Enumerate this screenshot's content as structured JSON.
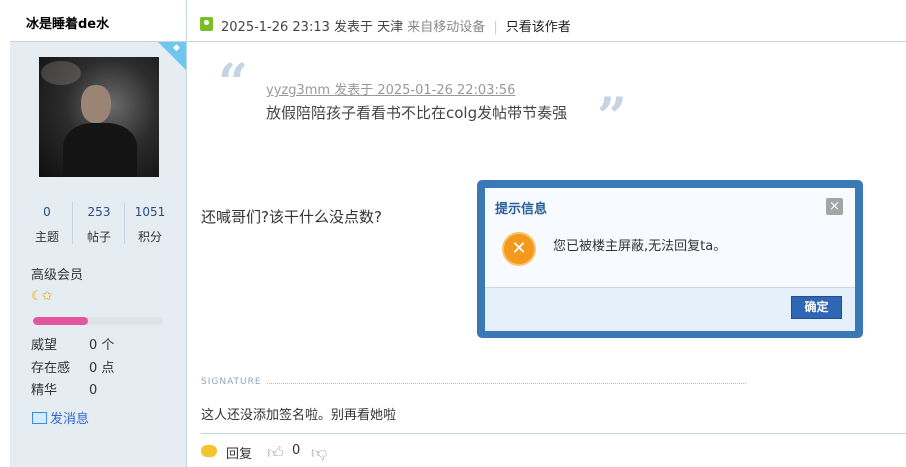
{
  "author": {
    "name": "冰是睡着de水",
    "stats": [
      {
        "value": "0",
        "label": "主题"
      },
      {
        "value": "253",
        "label": "帖子"
      },
      {
        "value": "1051",
        "label": "积分"
      }
    ],
    "group": "高级会员",
    "level_icons": "☾✩",
    "progress_fraction": 0.42,
    "progress_color": "#e4579e",
    "props": [
      {
        "label": "威望",
        "value": "0 个"
      },
      {
        "label": "存在感",
        "value": "0 点"
      },
      {
        "label": "精华",
        "value": "0"
      }
    ],
    "send_message": "发消息"
  },
  "post_header": {
    "datetime": "2025-1-26 23:13",
    "posted_in": "发表于 天津",
    "device": "来自移动设备",
    "separator": "|",
    "only_author": "只看该作者"
  },
  "quote": {
    "open_mark": "“",
    "close_mark": "”",
    "meta": "yyzg3mm 发表于 2025-01-26 22:03:56",
    "text": "放假陪陪孩子看看书不比在colg发帖带节奏强"
  },
  "post_body": "还喊哥们?该干什么没点数?",
  "signature": {
    "label": "SIGNATURE",
    "text": "这人还没添加签名啦。别再看她啦"
  },
  "actions": {
    "reply": "回复",
    "like_count": "0"
  },
  "dialog": {
    "title": "提示信息",
    "close_glyph": "×",
    "error_glyph": "✕",
    "message": "您已被楼主屏蔽,无法回复ta。",
    "confirm": "确定"
  }
}
